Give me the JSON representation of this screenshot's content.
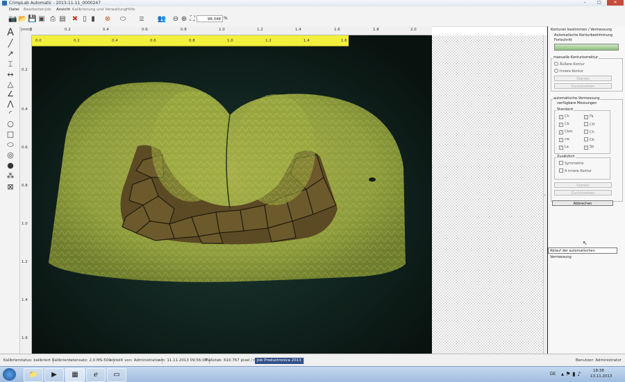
{
  "window": {
    "title": "CrimpLab Automatic - 2013-11-11_0000247",
    "min": "–",
    "max": "□",
    "close": "✕"
  },
  "menu": [
    "Datei",
    "Bearbeiten",
    "Job",
    "Ansicht",
    "Kalibrierung und Verwaltung",
    "Hilfe"
  ],
  "toolbar": {
    "zoom_value": "98,348",
    "zoom_unit": "%"
  },
  "ruler": {
    "unit": "[mm]",
    "top_ticks": [
      "0",
      "0.2",
      "0.4",
      "0.6",
      "0.8",
      "1.0",
      "1.2",
      "1.4",
      "1.6",
      "1.8",
      "2.0"
    ],
    "yellow_ticks": [
      "0.0",
      "0.2",
      "0.4",
      "0.6",
      "0.8",
      "1.0",
      "1.2",
      "1.4",
      "1.6"
    ],
    "left_ticks": [
      "0.2",
      "0.4",
      "0.6",
      "0.8",
      "1.0",
      "1.2",
      "1.4",
      "1.6"
    ]
  },
  "panel": {
    "title": "Konturen bestimmen / Vermessung",
    "subtitle": "Automatische Konturbestimmung",
    "progress_label": "Fortschritt",
    "progress": 0.0,
    "manual": {
      "label": "manuelle Konturkorrektur",
      "outer": "Äußere Kontur",
      "inner": "Innere Kontur",
      "start": "Starten",
      "reset": "Zurücksetzen"
    },
    "auto": {
      "label": "automatische Vermessung",
      "available": "verfügbare Messungen",
      "standard": "Standard",
      "left_items": [
        "Ch",
        "Cb",
        "Cbm",
        "cw",
        "La"
      ],
      "right_items": [
        "Fa",
        "CH",
        "Ch",
        "Cb",
        "Sb"
      ],
      "left_checked": [
        true,
        true,
        true,
        true,
        true
      ],
      "right_checked": [
        true,
        false,
        false,
        false,
        true
      ],
      "extra": "Zusätzlich",
      "extra_items": [
        "Symmetrie",
        "A innere Kontur"
      ],
      "start": "Starten",
      "reset": "Zurücksetzen"
    },
    "cancel": "Abbrechen",
    "tooltip": "Ablauf der automatischen Vermessung"
  },
  "status": {
    "calib_state": "Kalibrierstatus: kalibriert",
    "calib_data": "Kalibrierdatensatz: 2.0 MS-500",
    "created_by": "erstellt von: Administrator",
    "date": "am: 11.11.2013 09:56:07",
    "scale": "Maßstab: 610.767 pixel / mm",
    "job": "Job Productronica 2013",
    "user": "Benutzer: Administrator"
  },
  "taskbar": {
    "lang": "DE",
    "time": "18:38",
    "date": "13.11.2013"
  }
}
